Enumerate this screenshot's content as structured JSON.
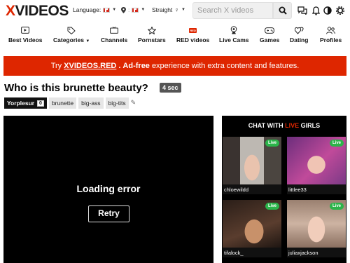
{
  "header": {
    "logo_x": "X",
    "logo_rest": "VIDEOS",
    "language_label": "Language:",
    "orientation_label": "Straight",
    "search_placeholder": "Search X videos"
  },
  "nav": [
    {
      "label": "Best Videos",
      "icon": "play-icon"
    },
    {
      "label": "Categories",
      "icon": "tag-icon"
    },
    {
      "label": "Channels",
      "icon": "tv-icon"
    },
    {
      "label": "Pornstars",
      "icon": "star-icon"
    },
    {
      "label": "RED videos",
      "icon": "red-badge-icon"
    },
    {
      "label": "Live Cams",
      "icon": "webcam-icon"
    },
    {
      "label": "Games",
      "icon": "gamepad-icon"
    },
    {
      "label": "Dating",
      "icon": "hearts-icon"
    },
    {
      "label": "Profiles",
      "icon": "users-icon"
    }
  ],
  "banner": {
    "pre": "Try",
    "brand": "XVIDEOS.RED",
    "adfree": "Ad-free",
    "post": "experience with extra content and features."
  },
  "video": {
    "title": "Who is this brunette beauty?",
    "duration": "4 sec",
    "uploader": "Yorplesur",
    "uploader_count": "0",
    "tags": [
      "brunette",
      "big-ass",
      "big-tits"
    ],
    "error_text": "Loading error",
    "retry_label": "Retry"
  },
  "chat": {
    "head_pre": "CHAT WITH",
    "head_live": "LIVE",
    "head_post": "GIRLS",
    "live_label": "Live",
    "cams": [
      "chloewildd",
      "littlee33",
      "tifalock_",
      "juliaxjackson"
    ]
  },
  "colors": {
    "brand_red": "#de2600",
    "live_green": "#2bb44a"
  }
}
